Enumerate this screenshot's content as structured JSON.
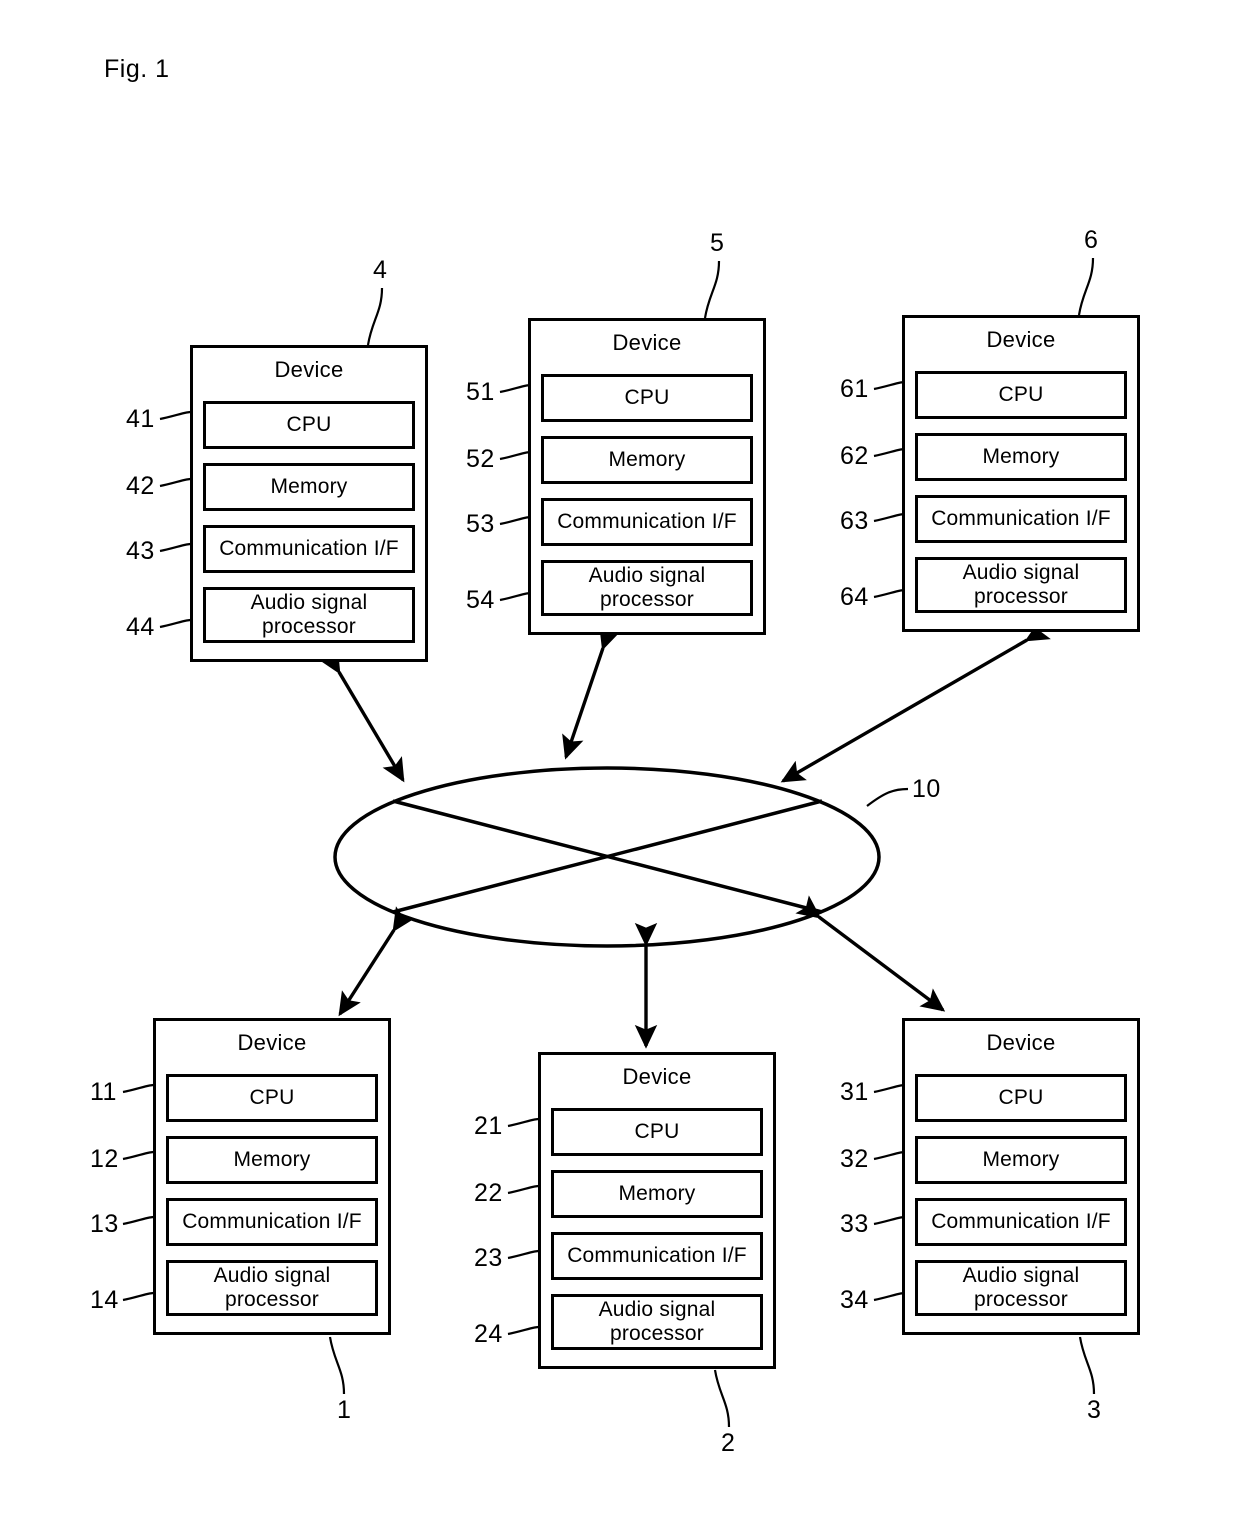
{
  "figure": {
    "label": "Fig. 1",
    "network_ref": "10"
  },
  "component_labels": {
    "device": "Device",
    "cpu": "CPU",
    "memory": "Memory",
    "communication_if": "Communication I/F",
    "audio_signal_processor": "Audio signal\nprocessor"
  },
  "devices": [
    {
      "id": "device-4",
      "title": "Device",
      "ref": "4",
      "components": [
        {
          "name": "cpu",
          "label": "CPU",
          "ref": "41"
        },
        {
          "name": "memory",
          "label": "Memory",
          "ref": "42"
        },
        {
          "name": "communication-if",
          "label": "Communication I/F",
          "ref": "43"
        },
        {
          "name": "audio-signal-processor",
          "label": "Audio signal\nprocessor",
          "ref": "44"
        }
      ]
    },
    {
      "id": "device-5",
      "title": "Device",
      "ref": "5",
      "components": [
        {
          "name": "cpu",
          "label": "CPU",
          "ref": "51"
        },
        {
          "name": "memory",
          "label": "Memory",
          "ref": "52"
        },
        {
          "name": "communication-if",
          "label": "Communication I/F",
          "ref": "53"
        },
        {
          "name": "audio-signal-processor",
          "label": "Audio signal\nprocessor",
          "ref": "54"
        }
      ]
    },
    {
      "id": "device-6",
      "title": "Device",
      "ref": "6",
      "components": [
        {
          "name": "cpu",
          "label": "CPU",
          "ref": "61"
        },
        {
          "name": "memory",
          "label": "Memory",
          "ref": "62"
        },
        {
          "name": "communication-if",
          "label": "Communication I/F",
          "ref": "63"
        },
        {
          "name": "audio-signal-processor",
          "label": "Audio signal\nprocessor",
          "ref": "64"
        }
      ]
    },
    {
      "id": "device-1",
      "title": "Device",
      "ref": "1",
      "components": [
        {
          "name": "cpu",
          "label": "CPU",
          "ref": "11"
        },
        {
          "name": "memory",
          "label": "Memory",
          "ref": "12"
        },
        {
          "name": "communication-if",
          "label": "Communication I/F",
          "ref": "13"
        },
        {
          "name": "audio-signal-processor",
          "label": "Audio signal\nprocessor",
          "ref": "14"
        }
      ]
    },
    {
      "id": "device-2",
      "title": "Device",
      "ref": "2",
      "components": [
        {
          "name": "cpu",
          "label": "CPU",
          "ref": "21"
        },
        {
          "name": "memory",
          "label": "Memory",
          "ref": "22"
        },
        {
          "name": "communication-if",
          "label": "Communication I/F",
          "ref": "23"
        },
        {
          "name": "audio-signal-processor",
          "label": "Audio signal\nprocessor",
          "ref": "24"
        }
      ]
    },
    {
      "id": "device-3",
      "title": "Device",
      "ref": "3",
      "components": [
        {
          "name": "cpu",
          "label": "CPU",
          "ref": "31"
        },
        {
          "name": "memory",
          "label": "Memory",
          "ref": "32"
        },
        {
          "name": "communication-if",
          "label": "Communication I/F",
          "ref": "33"
        },
        {
          "name": "audio-signal-processor",
          "label": "Audio signal\nprocessor",
          "ref": "34"
        }
      ]
    }
  ],
  "network": {
    "ref": "10",
    "shape": "ellipse"
  },
  "connections": [
    {
      "from": "device-4",
      "to": "network",
      "type": "bidirectional"
    },
    {
      "from": "device-5",
      "to": "network",
      "type": "bidirectional"
    },
    {
      "from": "device-6",
      "to": "network",
      "type": "bidirectional"
    },
    {
      "from": "device-1",
      "to": "network",
      "type": "bidirectional"
    },
    {
      "from": "device-2",
      "to": "network",
      "type": "bidirectional"
    },
    {
      "from": "device-3",
      "to": "network",
      "type": "bidirectional"
    }
  ],
  "colors": {
    "line": "#000000",
    "background": "#ffffff"
  }
}
